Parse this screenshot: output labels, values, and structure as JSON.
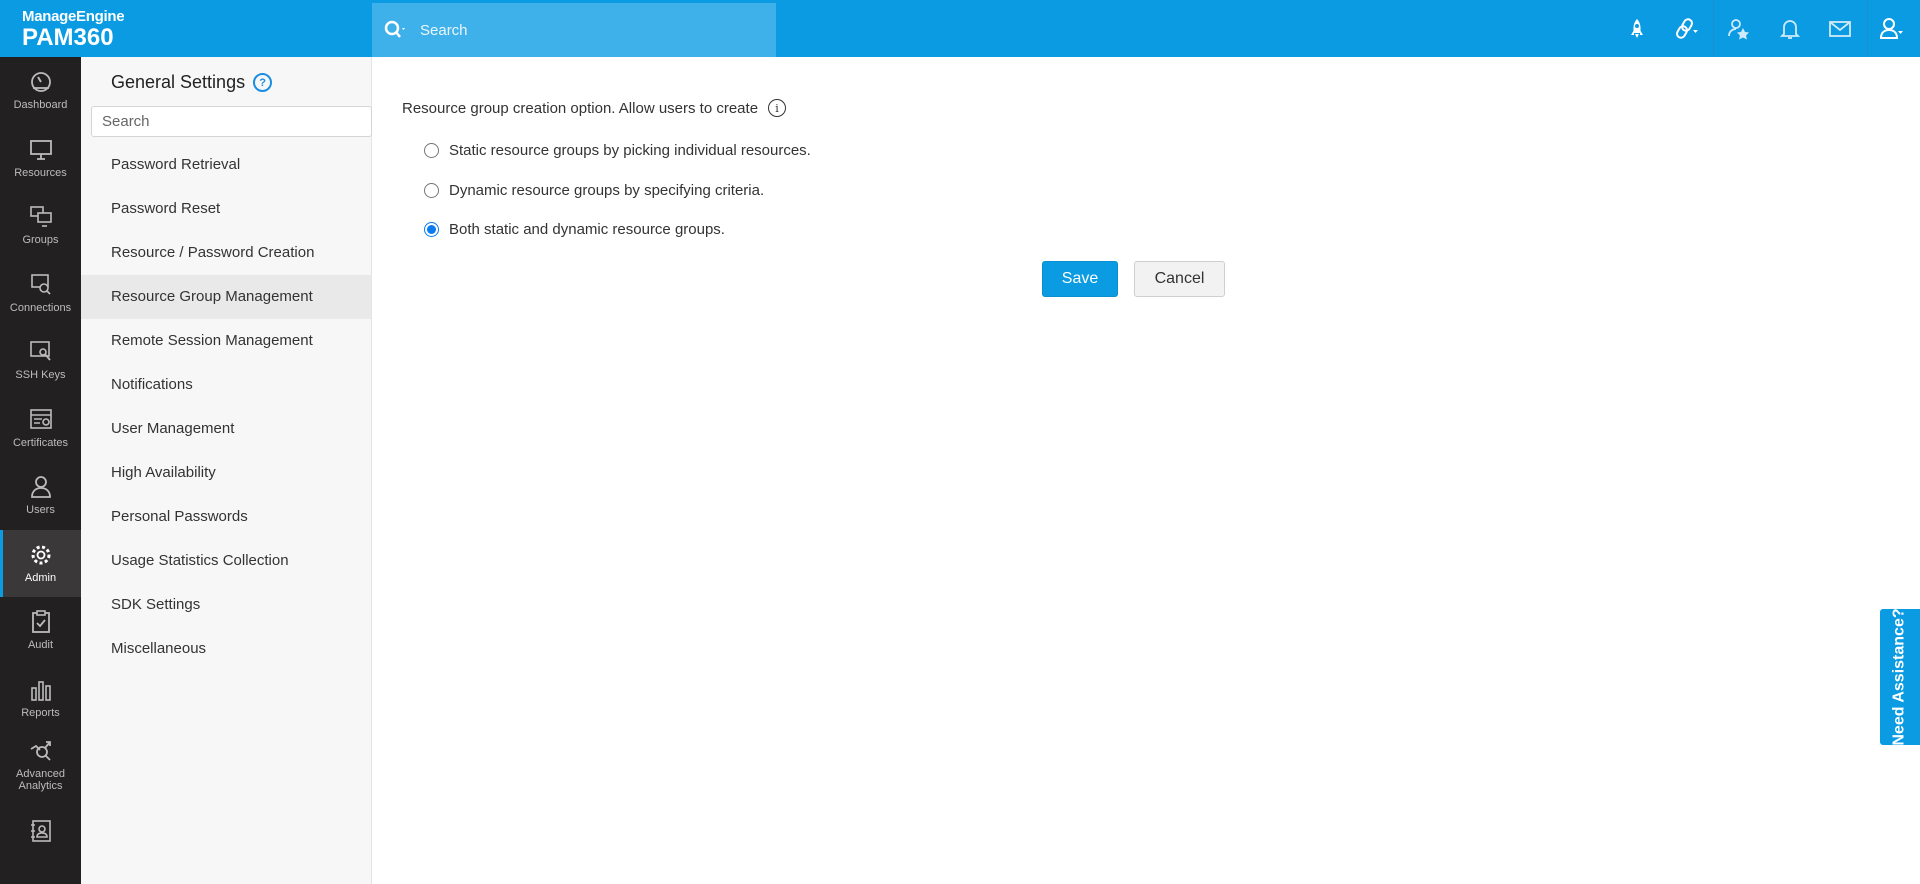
{
  "header": {
    "brand": "ManageEngine",
    "product": "PAM360",
    "search_placeholder": "Search",
    "icons": [
      "rocket-icon",
      "link-icon",
      "user-star-icon",
      "bell-icon",
      "mail-icon",
      "user-icon"
    ]
  },
  "nav": {
    "items": [
      {
        "label": "Dashboard",
        "icon": "dashboard-icon"
      },
      {
        "label": "Resources",
        "icon": "monitor-icon"
      },
      {
        "label": "Groups",
        "icon": "groups-icon"
      },
      {
        "label": "Connections",
        "icon": "connections-icon"
      },
      {
        "label": "SSH Keys",
        "icon": "key-icon"
      },
      {
        "label": "Certificates",
        "icon": "certificate-icon"
      },
      {
        "label": "Users",
        "icon": "user-icon"
      },
      {
        "label": "Admin",
        "icon": "gear-icon",
        "active": true
      },
      {
        "label": "Audit",
        "icon": "clipboard-icon"
      },
      {
        "label": "Reports",
        "icon": "bar-chart-icon"
      },
      {
        "label": "Advanced Analytics",
        "icon": "analytics-icon"
      },
      {
        "label": "",
        "icon": "contacts-icon"
      }
    ]
  },
  "panel": {
    "title": "General Settings",
    "help": "?",
    "search_placeholder": "Search",
    "items": [
      "Password Retrieval",
      "Password Reset",
      "Resource / Password Creation",
      "Resource Group Management",
      "Remote Session Management",
      "Notifications",
      "User Management",
      "High Availability",
      "Personal Passwords",
      "Usage Statistics Collection",
      "SDK Settings",
      "Miscellaneous"
    ],
    "active": "Resource Group Management"
  },
  "main": {
    "question": "Resource group creation option. Allow users to create",
    "info": "i",
    "options": [
      {
        "label": "Static resource groups by picking individual resources.",
        "checked": false
      },
      {
        "label": "Dynamic resource groups by specifying criteria.",
        "checked": false
      },
      {
        "label": "Both static and dynamic resource groups.",
        "checked": true
      }
    ],
    "save_label": "Save",
    "cancel_label": "Cancel"
  },
  "assist_label": "Need Assistance?",
  "colors": {
    "brand": "#0a9be3",
    "nav_bg": "#222021"
  }
}
